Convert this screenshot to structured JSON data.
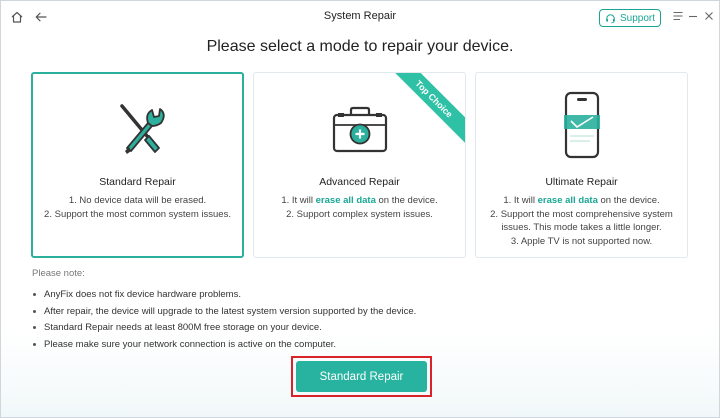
{
  "titlebar": {
    "title": "System Repair",
    "support_label": "Support",
    "home_icon": "home-icon",
    "back_icon": "back-arrow-icon",
    "menu_icon": "menu-icon",
    "minimize_icon": "minimize-icon",
    "close_icon": "close-icon"
  },
  "heading": "Please select a mode to repair your device.",
  "cards": [
    {
      "title": "Standard Repair",
      "icon": "wrench-screwdriver-icon",
      "selected": true,
      "desc": [
        "1. No device data will be erased.",
        "2. Support the most common system issues."
      ]
    },
    {
      "title": "Advanced Repair",
      "icon": "toolbox-icon",
      "ribbon": "Top Choice",
      "desc_pre": "1. It will ",
      "desc_hl": "erase all data",
      "desc_post": " on the device.",
      "desc2": "2. Support complex system issues."
    },
    {
      "title": "Ultimate Repair",
      "icon": "phone-scan-icon",
      "desc_pre": "1. It will ",
      "desc_hl": "erase all data",
      "desc_post": " on the device.",
      "desc2": "2. Support the most comprehensive system",
      "desc3": "issues. This mode takes a little longer.",
      "desc4": "3. Apple TV is not supported now."
    }
  ],
  "notes": {
    "header": "Please note:",
    "items": [
      "AnyFix does not fix device hardware problems.",
      "After repair, the device will upgrade to the latest system version supported by the device.",
      "Standard Repair needs at least 800M free storage on your device.",
      "Please make sure your network connection is active on the computer."
    ]
  },
  "action_button": "Standard Repair",
  "colors": {
    "accent": "#27b39f",
    "highlight": "#19a794",
    "frame": "#d9232b"
  }
}
